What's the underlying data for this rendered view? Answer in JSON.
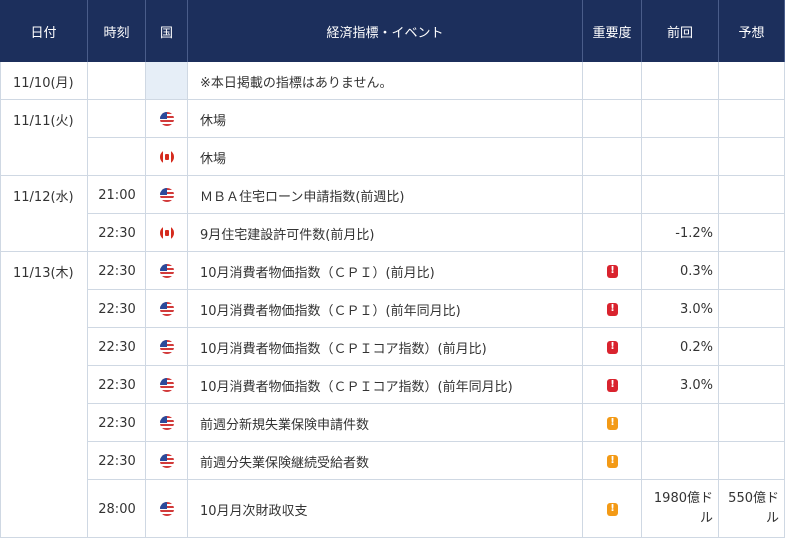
{
  "header": {
    "date": "日付",
    "time": "時刻",
    "country": "国",
    "event": "経済指標・イベント",
    "importance": "重要度",
    "previous": "前回",
    "forecast": "予想"
  },
  "colors": {
    "header_bg": "#1c2f5c",
    "importance_high": "#d9232e",
    "importance_mid": "#f39a16"
  },
  "rows": [
    {
      "date": "11/10(月)",
      "time": "",
      "country": "",
      "event": "※本日掲載の指標はありません。",
      "importance": "",
      "previous": "",
      "forecast": ""
    },
    {
      "date": "11/11(火)",
      "time": "",
      "country": "us",
      "event": "休場",
      "importance": "",
      "previous": "",
      "forecast": ""
    },
    {
      "date": "",
      "time": "",
      "country": "ca",
      "event": "休場",
      "importance": "",
      "previous": "",
      "forecast": ""
    },
    {
      "date": "11/12(水)",
      "time": "21:00",
      "country": "us",
      "event": "ＭＢＡ住宅ローン申請指数(前週比)",
      "importance": "",
      "previous": "",
      "forecast": ""
    },
    {
      "date": "",
      "time": "22:30",
      "country": "ca",
      "event": "9月住宅建設許可件数(前月比)",
      "importance": "",
      "previous": "-1.2%",
      "forecast": ""
    },
    {
      "date": "11/13(木)",
      "time": "22:30",
      "country": "us",
      "event": "10月消費者物価指数（ＣＰＩ）(前月比)",
      "importance": "high",
      "previous": "0.3%",
      "forecast": ""
    },
    {
      "date": "",
      "time": "22:30",
      "country": "us",
      "event": "10月消費者物価指数（ＣＰＩ）(前年同月比)",
      "importance": "high",
      "previous": "3.0%",
      "forecast": ""
    },
    {
      "date": "",
      "time": "22:30",
      "country": "us",
      "event": "10月消費者物価指数（ＣＰＩコア指数）(前月比)",
      "importance": "high",
      "previous": "0.2%",
      "forecast": ""
    },
    {
      "date": "",
      "time": "22:30",
      "country": "us",
      "event": "10月消費者物価指数（ＣＰＩコア指数）(前年同月比)",
      "importance": "high",
      "previous": "3.0%",
      "forecast": ""
    },
    {
      "date": "",
      "time": "22:30",
      "country": "us",
      "event": "前週分新規失業保険申請件数",
      "importance": "mid",
      "previous": "",
      "forecast": ""
    },
    {
      "date": "",
      "time": "22:30",
      "country": "us",
      "event": "前週分失業保険継続受給者数",
      "importance": "mid",
      "previous": "",
      "forecast": ""
    },
    {
      "date": "",
      "time": "28:00",
      "country": "us",
      "event": "10月月次財政収支",
      "importance": "mid",
      "previous": "1980億ドル",
      "forecast": "550億ドル"
    }
  ]
}
